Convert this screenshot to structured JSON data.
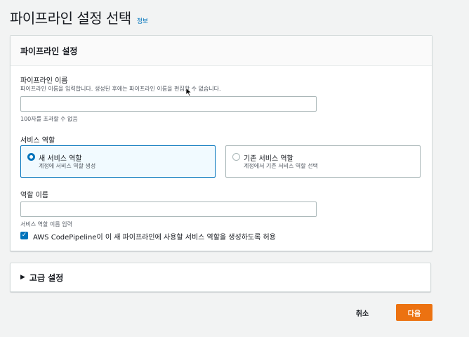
{
  "page": {
    "title": "파이프라인 설정 선택",
    "info_link": "정보"
  },
  "pipeline_settings": {
    "header": "파이프라인 설정",
    "name_label": "파이프라인 이름",
    "name_description": "파이프라인 이름을 입력합니다. 생성된 후에는 파이프라인 이름을 편집할 수 없습니다.",
    "name_value": "",
    "name_constraint": "100자를 초과할 수 없음",
    "service_role_label": "서비스 역할",
    "service_role_options": [
      {
        "label": "새 서비스 역할",
        "description": "계정에 서비스 역할 생성",
        "selected": true
      },
      {
        "label": "기존 서비스 역할",
        "description": "계정에서 기존 서비스 역할 선택",
        "selected": false
      }
    ],
    "role_name_label": "역할 이름",
    "role_name_value": "",
    "role_name_hint": "서비스 역할 이름 입력",
    "allow_checkbox_label": "AWS CodePipeline이 이 새 파이프라인에 사용할 서비스 역할을 생성하도록 허용",
    "allow_checkbox_checked": true
  },
  "advanced": {
    "title": "고급 설정"
  },
  "footer": {
    "cancel_label": "취소",
    "next_label": "다음"
  },
  "colors": {
    "accent": "#0073bb",
    "primary_button": "#ec7211",
    "background": "#f2f3f3"
  }
}
